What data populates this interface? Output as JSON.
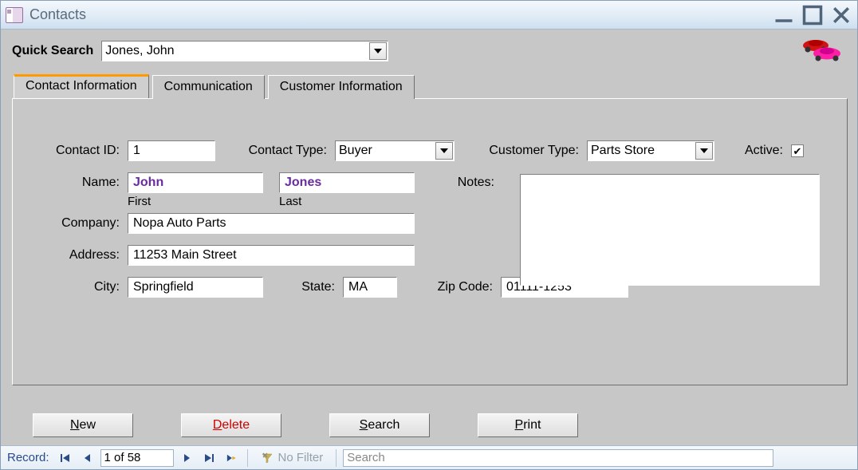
{
  "window": {
    "title": "Contacts"
  },
  "quickSearch": {
    "label": "Quick Search",
    "value": "Jones, John"
  },
  "tabs": [
    {
      "label": "Contact Information"
    },
    {
      "label": "Communication"
    },
    {
      "label": "Customer Information"
    }
  ],
  "form": {
    "contactIdLabel": "Contact ID:",
    "contactId": "1",
    "contactTypeLabel": "Contact Type:",
    "contactType": "Buyer",
    "customerTypeLabel": "Customer Type:",
    "customerType": "Parts Store",
    "activeLabel": "Active:",
    "activeChecked": "✔",
    "nameLabel": "Name:",
    "firstName": "John",
    "firstSub": "First",
    "lastName": "Jones",
    "lastSub": "Last",
    "notesLabel": "Notes:",
    "notes": "",
    "companyLabel": "Company:",
    "company": "Nopa Auto Parts",
    "addressLabel": "Address:",
    "address": "11253 Main Street",
    "cityLabel": "City:",
    "city": "Springfield",
    "stateLabel": "State:",
    "state": "MA",
    "zipLabel": "Zip Code:",
    "zip": "01111-1253"
  },
  "buttons": {
    "new": "New",
    "delete": "Delete",
    "search": "Search",
    "print": "Print"
  },
  "recordNav": {
    "label": "Record:",
    "position": "1 of 58",
    "filter": "No Filter",
    "searchPlaceholder": "Search"
  }
}
